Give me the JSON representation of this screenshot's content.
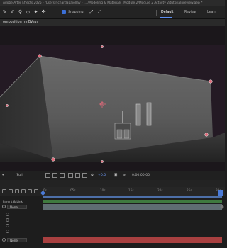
{
  "app": {
    "title": "Adobe After Effects 2025 - /Users/richardapaiollay - ... /Modeling & Materials /Module 2/Module 2 Activity 2/tutorialpreview.aep *"
  },
  "toolbar": {
    "snapping_label": "Snapping",
    "snapping_checked": true,
    "workspaces": [
      {
        "label": "Default",
        "active": true
      },
      {
        "label": "Review",
        "active": false
      },
      {
        "label": "Learn",
        "active": false
      }
    ]
  },
  "composition": {
    "tab_label": "omposition mnBVeys"
  },
  "viewer_controls": {
    "resolution": "(Full)",
    "exposure": "+0.0",
    "timecode": "0;00;00;00"
  },
  "timeline": {
    "ruler_labels": [
      "0s",
      "05s",
      "10s",
      "15s",
      "20s",
      "25s",
      "30s"
    ],
    "column_header": "Parent & Link",
    "layers": [
      {
        "parent": "None"
      },
      {
        "parent": "None"
      }
    ]
  },
  "colors": {
    "accent": "#5b8df2",
    "handle": "#e06a7a",
    "layer_green": "#3f7a3f",
    "layer_gray": "#5f6d72",
    "layer_red": "#a84040"
  }
}
